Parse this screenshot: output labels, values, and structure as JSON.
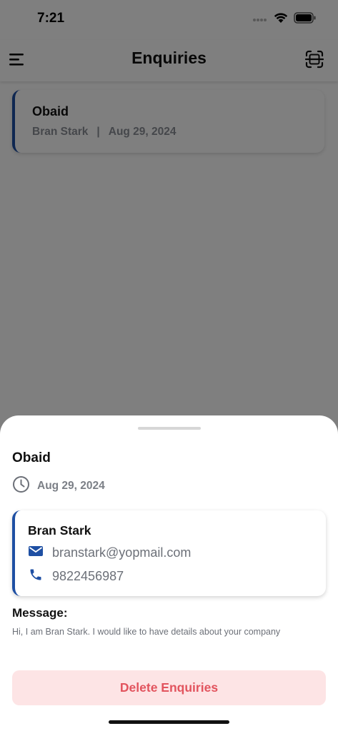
{
  "status_bar": {
    "time": "7:21"
  },
  "header": {
    "title": "Enquiries",
    "menu_icon": "hamburger-menu-icon",
    "scan_icon": "scan-icon"
  },
  "list": {
    "items": [
      {
        "name": "Obaid",
        "contact": "Bran Stark",
        "separator": "|",
        "date": "Aug 29, 2024"
      }
    ]
  },
  "sheet": {
    "name": "Obaid",
    "date": "Aug 29, 2024",
    "contact": {
      "name": "Bran Stark",
      "email": "branstark@yopmail.com",
      "phone": "9822456987"
    },
    "message_label": "Message:",
    "message_text": "Hi, I am Bran Stark. I would like to have details about your company",
    "delete_label": "Delete Enquiries"
  },
  "colors": {
    "accent_blue": "#1e4fa3",
    "delete_text": "#e2545e",
    "delete_bg": "#fde4e5"
  }
}
